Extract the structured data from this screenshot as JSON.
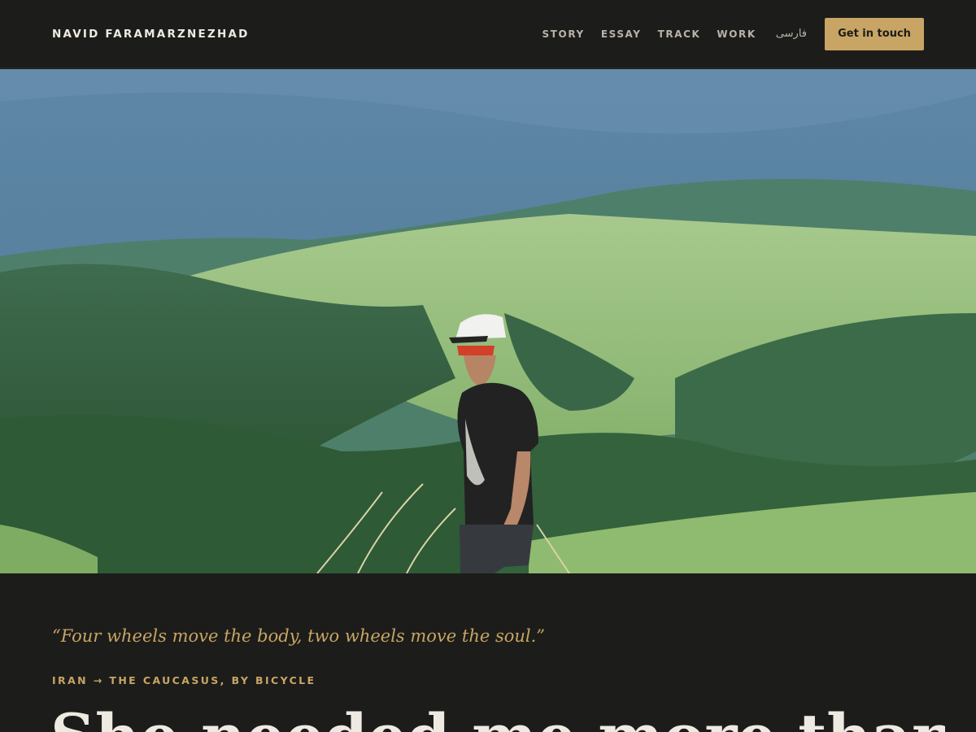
{
  "header": {
    "brand": "NAVID FARAMARZNEZHAD",
    "nav": [
      {
        "label": "STORY"
      },
      {
        "label": "ESSAY"
      },
      {
        "label": "TRACK"
      },
      {
        "label": "WORK"
      }
    ],
    "language": "فارسی",
    "cta_label": "Get in touch"
  },
  "hero": {
    "image_subject": "cyclist in cap and sunglasses standing on a grassy ridge above forested Caucasus mountains"
  },
  "intro": {
    "quote": "“Four wheels move the body, two wheels move the soul.”",
    "eyebrow": "IRAN → THE CAUCASUS, BY BICYCLE",
    "headline": "She needed me more than I needed her"
  },
  "colors": {
    "background": "#1c1c1a",
    "accent": "#c8a564",
    "text": "#eeeae2",
    "nav_text": "#b9b3a8"
  }
}
